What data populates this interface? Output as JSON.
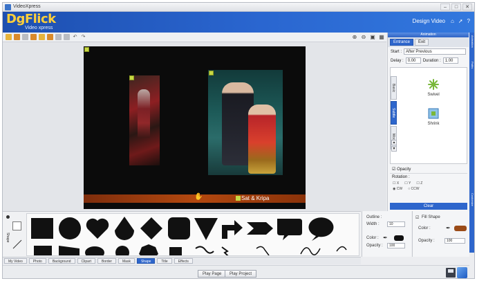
{
  "window": {
    "title": "VideoXpress",
    "controls": [
      "–",
      "□",
      "✕"
    ]
  },
  "header": {
    "logo_main": "DgFlick",
    "tagline": "Video xpress",
    "design_video": "Design Video"
  },
  "canvas": {
    "caption": "Sat & Kripa"
  },
  "right_panel": {
    "title": "Animation",
    "tabs": [
      "Entrance",
      "Exit"
    ],
    "start_label": "Start :",
    "start_value": "After Previous",
    "delay_label": "Delay :",
    "delay_value": "0.00",
    "duration_label": "Duration :",
    "duration_value": "1.00",
    "vtabs": [
      "Basic",
      "Subtle",
      "Mode"
    ],
    "effects": [
      "Swivel",
      "Shrink"
    ],
    "opacity_label": "Opacity",
    "rotation_label": "Rotation :",
    "axes": [
      "X",
      "Y",
      "Z"
    ],
    "directions": [
      "CW",
      "CCW"
    ],
    "clear_label": "Clear"
  },
  "side_strips": {
    "top": "Animation",
    "mid": "Paths",
    "bottom": "Customize"
  },
  "shapes_panel": {
    "side_label": "Shape",
    "outline_label": "Outline :",
    "width_label": "Width :",
    "width_value": "10",
    "color_label": "Color :",
    "opacity_label": "Opacity :",
    "opacity_value": "100",
    "fill_label": "Fill Shape",
    "fill_color_label": "Color :",
    "fill_opacity_label": "Opacity :",
    "fill_opacity_value": "100",
    "colors": {
      "outline": "#111111",
      "fill": "#9a4b18"
    }
  },
  "bottom_tabs": [
    "My Video",
    "Photo",
    "Background",
    "Clipart",
    "Border",
    "Mask",
    "Shape",
    "Title",
    "Effects"
  ],
  "bottom_tabs_active": "Shape",
  "footer": {
    "play_page": "Play Page",
    "play_project": "Play Project"
  }
}
